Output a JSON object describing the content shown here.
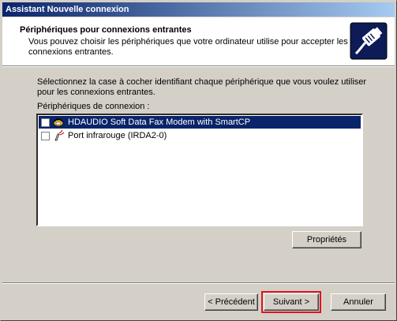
{
  "window": {
    "title": "Assistant Nouvelle connexion"
  },
  "header": {
    "title": "Périphériques pour connexions entrantes",
    "subtitle": "Vous pouvez choisir les périphériques que votre ordinateur utilise pour accepter les connexions entrantes."
  },
  "body": {
    "instruction": "Sélectionnez la case à cocher identifiant chaque périphérique que vous voulez utiliser pour les connexions entrantes.",
    "list_label": "Périphériques de connexion :",
    "devices": [
      {
        "label": "HDAUDIO Soft Data Fax Modem with SmartCP",
        "checked": false,
        "selected": true,
        "icon": "modem-icon"
      },
      {
        "label": "Port infrarouge (IRDA2-0)",
        "checked": false,
        "selected": false,
        "icon": "infrared-port-icon"
      }
    ],
    "properties_label": "Propriétés"
  },
  "footer": {
    "back_label": "< Précédent",
    "next_label": "Suivant >",
    "cancel_label": "Annuler"
  },
  "colors": {
    "titlebar": "#0a246a",
    "selection": "#0a246a",
    "highlight": "#e0141e",
    "face": "#d4d0c8"
  }
}
